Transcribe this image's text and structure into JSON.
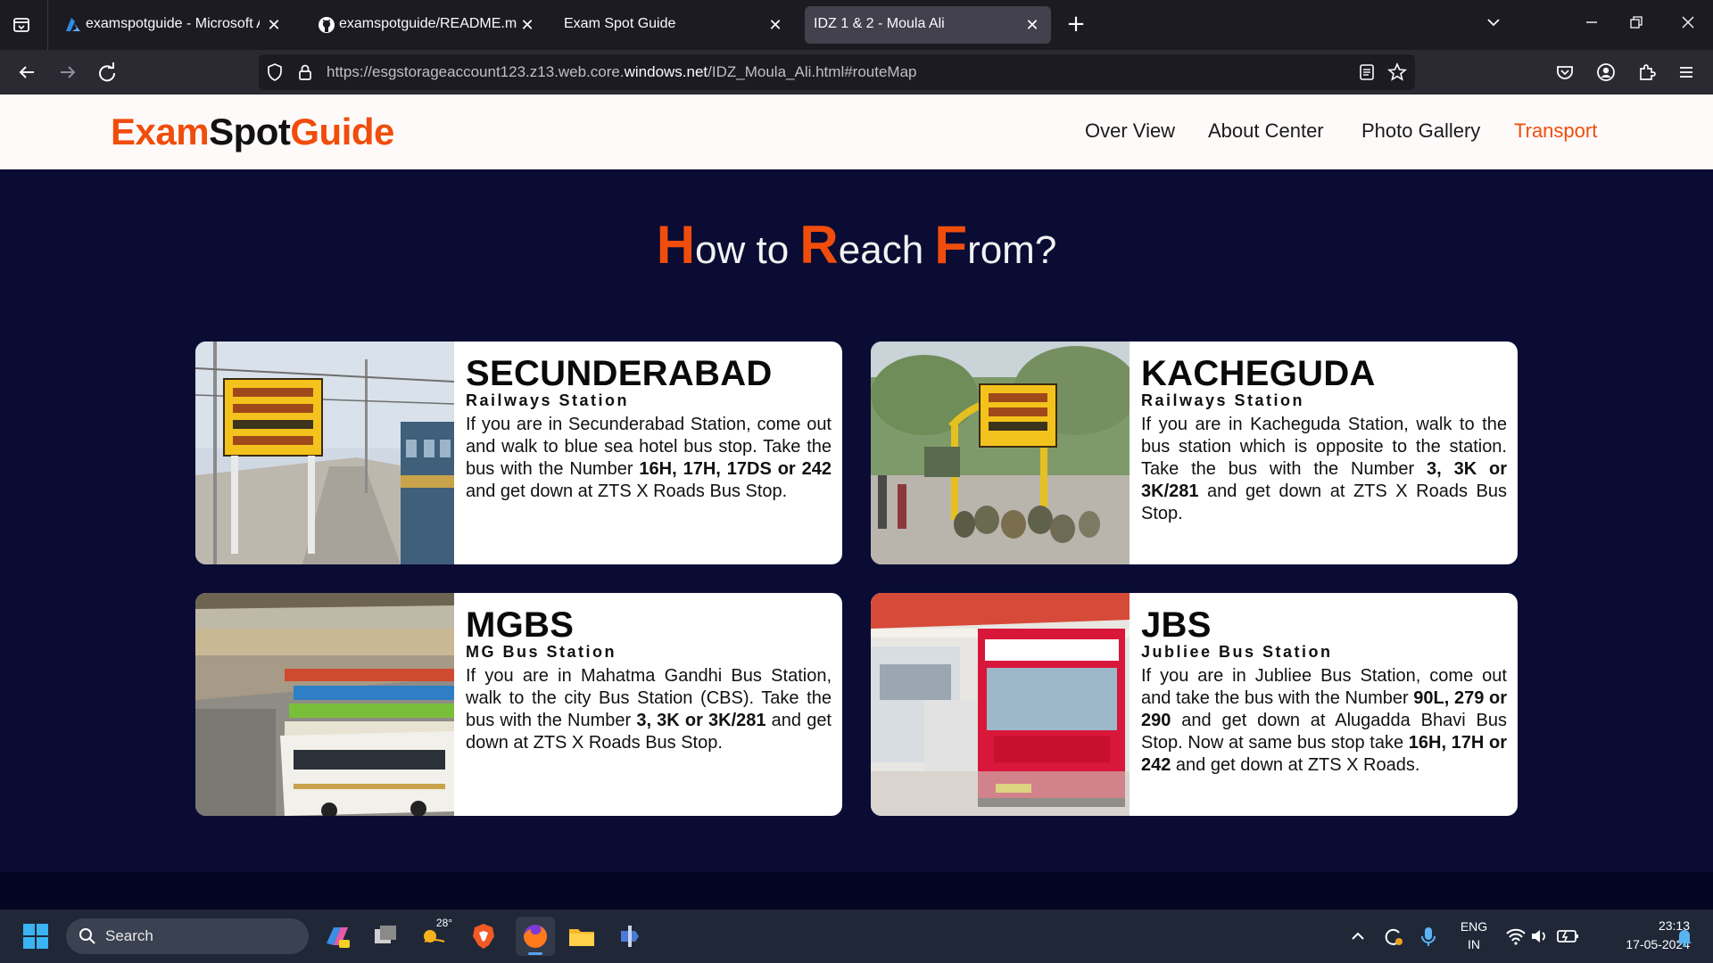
{
  "browser": {
    "tabs": [
      {
        "title": "examspotguide - Microsoft Azu",
        "icon": "azure-icon",
        "active": false
      },
      {
        "title": "examspotguide/README.md a",
        "icon": "github-icon",
        "active": false
      },
      {
        "title": "Exam Spot Guide",
        "icon": "",
        "active": false
      },
      {
        "title": "IDZ 1 & 2 - Moula Ali",
        "icon": "",
        "active": true
      }
    ],
    "url_prefix": "https://esgstorageaccount123.z13.web.core.",
    "url_domain": "windows.net",
    "url_suffix": "/IDZ_Moula_Ali.html#routeMap"
  },
  "site": {
    "logo_exam": "Exam",
    "logo_spot": "Spot",
    "logo_guide": "Guide",
    "nav": [
      "Over View",
      "About Center",
      "Photo Gallery",
      "Transport"
    ],
    "nav_active": "Transport",
    "heading": {
      "c1": "H",
      "w1": "ow to ",
      "c2": "R",
      "w2": "each ",
      "c3": "F",
      "w3": "rom?"
    }
  },
  "cards": [
    {
      "name": "SECUNDERABAD",
      "sub": "Railways Station",
      "desc_parts": [
        "If you are in Secunderabad Station, come out and walk to blue sea hotel bus stop. Take the bus with the Number ",
        "16H, 17H, 17DS or 242",
        " and get down at ZTS X Roads Bus Stop."
      ]
    },
    {
      "name": "KACHEGUDA",
      "sub": "Railways Station",
      "desc_parts": [
        "If you are in Kacheguda Station, walk to the bus station which is opposite to the station. Take the bus with the Number ",
        "3, 3K or 3K/281",
        " and get down at ZTS X Roads Bus Stop."
      ]
    },
    {
      "name": "MGBS",
      "sub": "MG Bus Station",
      "desc_parts": [
        "If you are in Mahatma Gandhi Bus Station, walk to the city Bus Station (CBS). Take the bus with the Number ",
        "3, 3K or 3K/281",
        " and get down at ZTS X Roads Bus Stop."
      ]
    },
    {
      "name": "JBS",
      "sub": "Jubliee Bus Station",
      "desc_parts": [
        "If you are in Jubliee Bus Station, come out and take the bus with the Number ",
        "90L, 279 or 290",
        " and get down at Alugadda Bhavi Bus Stop. Now at same bus stop take ",
        "16H, 17H or 242",
        " and get down at ZTS X Roads."
      ]
    }
  ],
  "taskbar": {
    "search_label": "Search",
    "weather_temp": "28°",
    "lang_line1": "ENG",
    "lang_line2": "IN",
    "time": "23:13",
    "date": "17-05-2024"
  },
  "colors": {
    "accent": "#f04d0c",
    "page_bg": "#0a0c34",
    "header_bg": "#fffafa"
  }
}
